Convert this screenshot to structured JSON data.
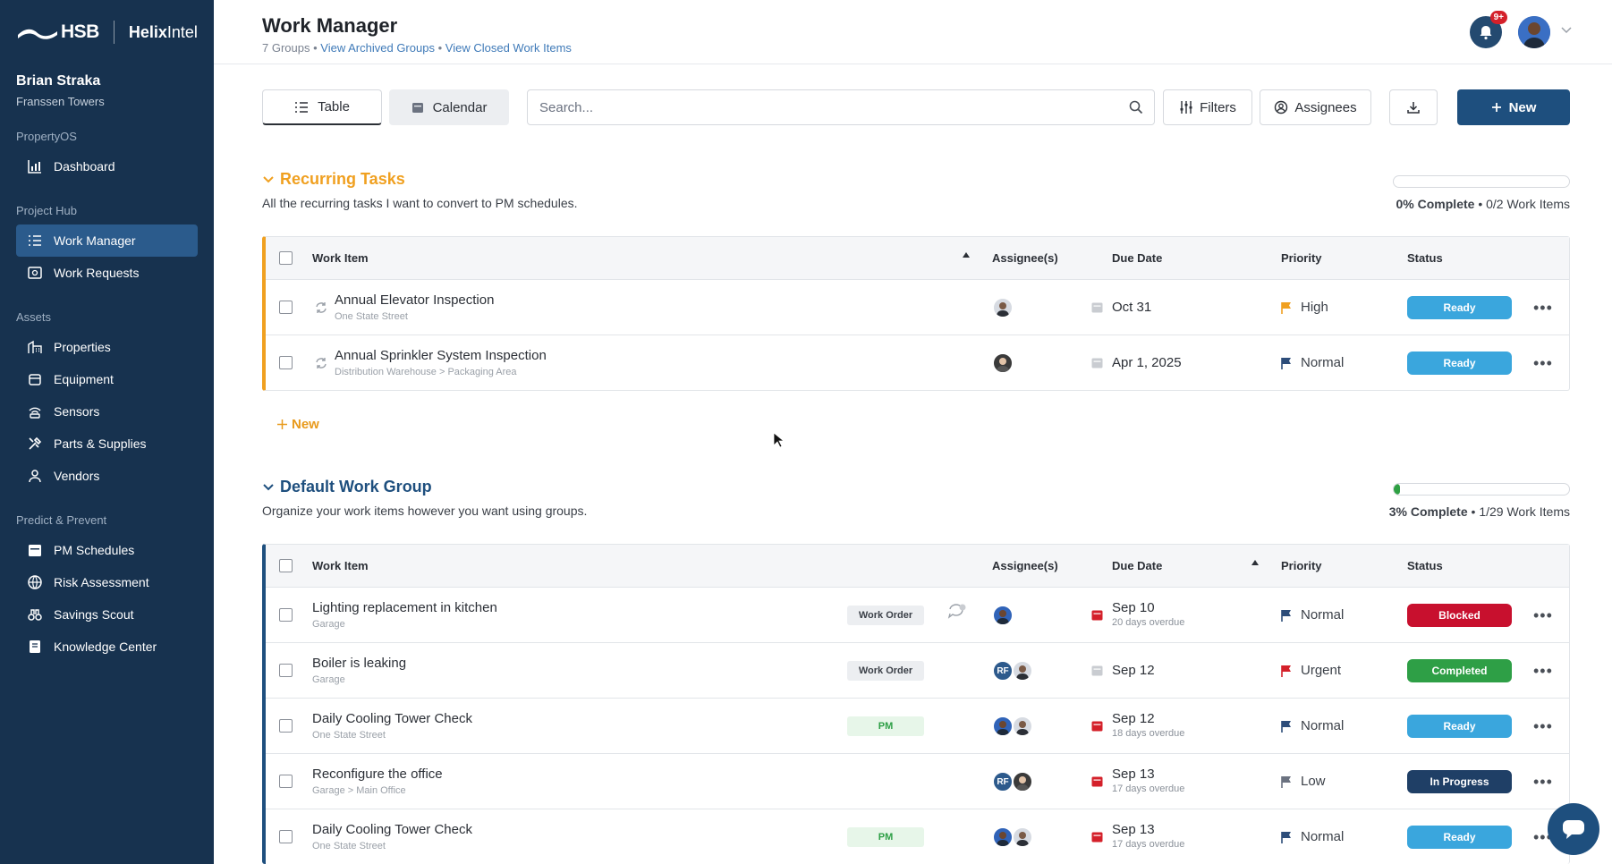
{
  "sidebar": {
    "brand_hsb": "HSB",
    "brand_helix_a": "Helix",
    "brand_helix_b": "Intel",
    "user_name": "Brian Straka",
    "user_org": "Franssen Towers",
    "sections": {
      "propertyos": "PropertyOS",
      "project_hub": "Project Hub",
      "assets": "Assets",
      "predict": "Predict & Prevent"
    },
    "items": {
      "dashboard": "Dashboard",
      "work_manager": "Work Manager",
      "work_requests": "Work Requests",
      "properties": "Properties",
      "equipment": "Equipment",
      "sensors": "Sensors",
      "parts": "Parts & Supplies",
      "vendors": "Vendors",
      "pm_schedules": "PM Schedules",
      "risk": "Risk Assessment",
      "savings": "Savings Scout",
      "knowledge": "Knowledge Center"
    }
  },
  "header": {
    "title": "Work Manager",
    "groups_count": "7 Groups",
    "sep": "•",
    "link_archived": "View Archived Groups",
    "link_closed": "View Closed Work Items",
    "notif_badge": "9+"
  },
  "toolbar": {
    "table_label": "Table",
    "calendar_label": "Calendar",
    "search_placeholder": "Search...",
    "filters_label": "Filters",
    "assignees_label": "Assignees",
    "new_label": "New"
  },
  "columns": {
    "work_item": "Work Item",
    "assignees": "Assignee(s)",
    "due_date": "Due Date",
    "priority": "Priority",
    "status": "Status"
  },
  "recurring": {
    "title": "Recurring Tasks",
    "desc": "All the recurring tasks I want to convert to PM schedules.",
    "progress_pct_label": "0% Complete",
    "progress_items": "• 0/2 Work Items",
    "progress_value": 0,
    "add_new": "New",
    "rows": [
      {
        "title": "Annual Elevator Inspection",
        "location": "One State Street",
        "due": "Oct 31",
        "priority": "High",
        "status": "Ready"
      },
      {
        "title": "Annual Sprinkler System Inspection",
        "location": "Distribution Warehouse > Packaging Area",
        "due": "Apr 1, 2025",
        "priority": "Normal",
        "status": "Ready"
      }
    ]
  },
  "default_group": {
    "title": "Default Work Group",
    "desc": "Organize your work items however you want using groups.",
    "progress_pct_label": "3% Complete",
    "progress_items": "• 1/29 Work Items",
    "progress_value": 0.03,
    "rows": [
      {
        "title": "Lighting replacement in kitchen",
        "location": "Garage",
        "tag": "Work Order",
        "due": "Sep 10",
        "overdue": "20 days overdue",
        "priority": "Normal",
        "status": "Blocked"
      },
      {
        "title": "Boiler is leaking",
        "location": "Garage",
        "tag": "Work Order",
        "due": "Sep 12",
        "overdue": "",
        "priority": "Urgent",
        "status": "Completed"
      },
      {
        "title": "Daily Cooling Tower Check",
        "location": "One State Street",
        "tag": "PM",
        "due": "Sep 12",
        "overdue": "18 days overdue",
        "priority": "Normal",
        "status": "Ready"
      },
      {
        "title": "Reconfigure the office",
        "location": "Garage > Main Office",
        "tag": "",
        "due": "Sep 13",
        "overdue": "17 days overdue",
        "priority": "Low",
        "status": "In Progress"
      },
      {
        "title": "Daily Cooling Tower Check",
        "location": "One State Street",
        "tag": "PM",
        "due": "Sep 13",
        "overdue": "17 days overdue",
        "priority": "Normal",
        "status": "Ready"
      }
    ],
    "initials": "RF"
  },
  "colors": {
    "sidebar_bg": "#17324f",
    "accent_blue": "#1e4f7e",
    "orange": "#f0a020",
    "status_ready": "#3aa6dd",
    "status_blocked": "#c8102e",
    "status_completed": "#2e9f46",
    "status_in_progress": "#1f3f66",
    "flag_high": "#f0a020",
    "flag_normal": "#2d4d7a",
    "flag_urgent": "#d4202a",
    "flag_low": "#6b7280"
  }
}
